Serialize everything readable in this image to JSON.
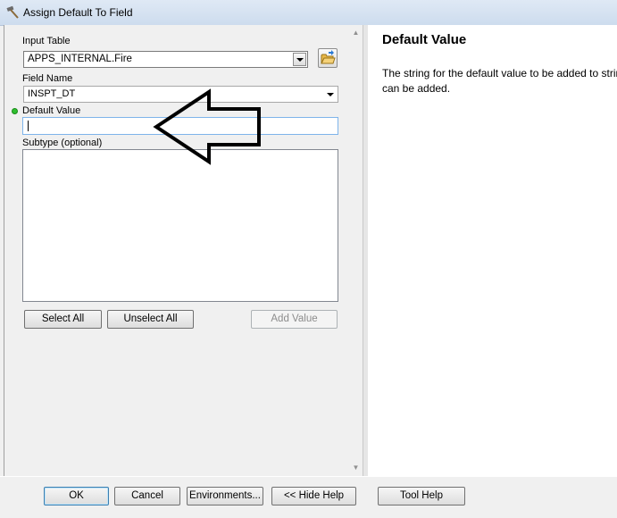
{
  "window": {
    "title": "Assign Default To Field",
    "icon": "hammer-icon"
  },
  "form": {
    "input_table": {
      "label": "Input Table",
      "value": "APPS_INTERNAL.Fire",
      "browse_icon": "open-folder-icon"
    },
    "field_name": {
      "label": "Field Name",
      "value": "INSPT_DT"
    },
    "default_value": {
      "label": "Default Value",
      "value": "",
      "required_indicator_color": "#2fbf2f"
    },
    "subtype": {
      "label": "Subtype (optional)",
      "items": []
    },
    "buttons": {
      "select_all": "Select All",
      "unselect_all": "Unselect All",
      "add_value": "Add Value"
    }
  },
  "help": {
    "title": "Default Value",
    "body": "The string for the default value to be added to string can be added."
  },
  "footer": {
    "ok": "OK",
    "cancel": "Cancel",
    "environments": "Environments...",
    "hide_help": "<< Hide Help",
    "tool_help": "Tool Help"
  },
  "annotation": {
    "icon": "left-arrow-annotation"
  }
}
